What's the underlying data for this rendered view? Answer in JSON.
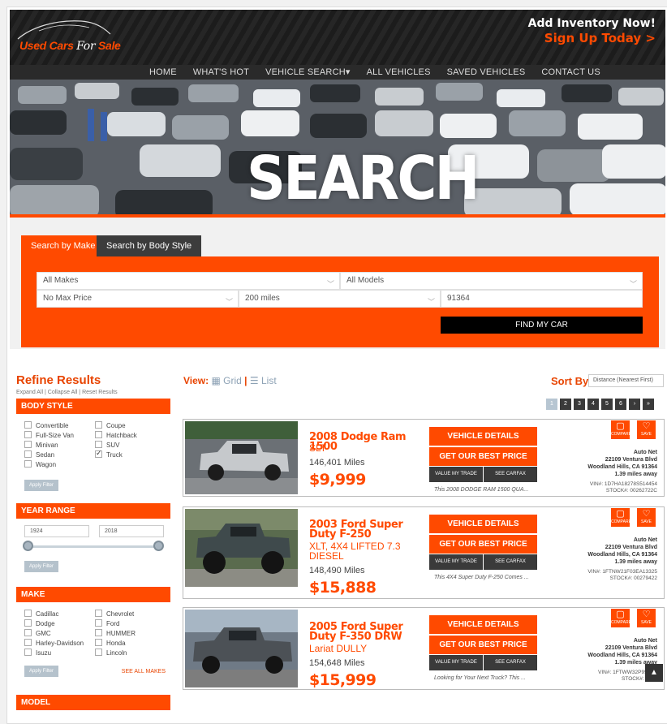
{
  "brand": {
    "name_part1": "Used Cars",
    "name_part2": "For",
    "name_part3": "Sale"
  },
  "cta": {
    "line1": "Add Inventory Now!",
    "line2": "Sign Up Today >"
  },
  "nav": [
    "HOME",
    "WHAT'S HOT",
    "VEHICLE SEARCH▾",
    "ALL VEHICLES",
    "SAVED VEHICLES",
    "CONTACT US"
  ],
  "hero": {
    "title": "SEARCH"
  },
  "search": {
    "tabs": [
      "Search by Make",
      "Search by Body Style"
    ],
    "make": "All Makes",
    "model": "All Models",
    "max_price": "No Max Price",
    "distance": "200 miles",
    "zip": "91364",
    "submit": "FIND MY CAR"
  },
  "sidebar": {
    "title": "Refine Results",
    "links": "Expand All | Collapse All | Reset Results",
    "body_style": {
      "heading": "BODY STYLE",
      "items": [
        "Convertible",
        "Coupe",
        "Full-Size Van",
        "Hatchback",
        "Minivan",
        "SUV",
        "Sedan",
        "Truck",
        "Wagon"
      ],
      "checked": "Truck",
      "apply": "Apply Filter"
    },
    "year_range": {
      "heading": "YEAR RANGE",
      "from": "1924",
      "to": "2018",
      "apply": "Apply Filter"
    },
    "make": {
      "heading": "MAKE",
      "items": [
        "Cadillac",
        "Chevrolet",
        "Dodge",
        "Ford",
        "GMC",
        "HUMMER",
        "Harley-Davidson",
        "Honda",
        "Isuzu",
        "Lincoln"
      ],
      "apply": "Apply Filter",
      "see_all": "SEE ALL MAKES"
    },
    "model": {
      "heading": "MODEL"
    }
  },
  "results": {
    "view_label": "View:",
    "grid": "Grid",
    "sep": "|",
    "list": "List",
    "sort_label": "Sort By:",
    "sort_value": "Distance (Nearest First)",
    "pages": [
      "1",
      "2",
      "3",
      "4",
      "5",
      "6",
      "›",
      "»"
    ],
    "current_page": "1",
    "buttons": {
      "details": "VEHICLE DETAILS",
      "best_price": "GET OUR BEST PRICE",
      "trade": "VALUE MY TRADE",
      "carfax": "SEE CARFAX",
      "compare": "COMPARE",
      "save": "SAVE"
    },
    "listings": [
      {
        "title": "2008 Dodge Ram 1500",
        "trim": "SLT",
        "miles": "146,401 Miles",
        "price": "$9,999",
        "desc": "This 2008 DODGE RAM 1500 QUA...",
        "dealer": "Auto Net",
        "address": "22109 Ventura Blvd",
        "city": "Woodland Hills, CA 91364",
        "distance": "1.39 miles away",
        "vin": "VIN#: 1D7HA18278S514454",
        "stock": "STOCK#: 00262722C"
      },
      {
        "title": "2003 Ford Super Duty F-250",
        "trim": "XLT, 4X4 LIFTED 7.3 DIESEL",
        "miles": "148,490 Miles",
        "price": "$15,888",
        "desc": "This 4X4 Super Duty F-250 Comes ...",
        "dealer": "Auto Net",
        "address": "22109 Ventura Blvd",
        "city": "Woodland Hills, CA 91364",
        "distance": "1.39 miles away",
        "vin": "VIN#: 1FTNW21F03EA13325",
        "stock": "STOCK#: 00279422"
      },
      {
        "title": "2005 Ford Super Duty F-350 DRW",
        "trim": "Lariat DULLY",
        "miles": "154,648 Miles",
        "price": "$15,999",
        "desc": "Looking for Your Next Truck? This ...",
        "dealer": "Auto Net",
        "address": "22109 Ventura Blvd",
        "city": "Woodland Hills, CA 91364",
        "distance": "1.39 miles away",
        "vin": "VIN#: 1FTWW32P95EA7",
        "stock": "STOCK#: 0027"
      }
    ]
  },
  "colors": {
    "accent": "#ff4a00",
    "dark": "#2a2a2a",
    "muted": "#8da2b5"
  }
}
